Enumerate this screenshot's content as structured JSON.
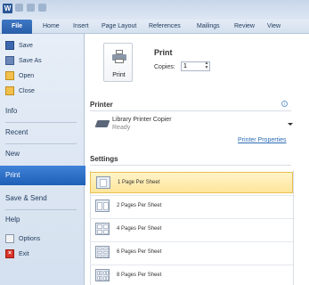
{
  "app": {
    "icon_letter": "W"
  },
  "ribbon": {
    "file_tab": "File",
    "tabs": [
      "Home",
      "Insert",
      "Page Layout",
      "References",
      "Mailings",
      "Review",
      "View"
    ]
  },
  "backstage": {
    "commands": [
      {
        "label": "Save",
        "icon": "save-icon"
      },
      {
        "label": "Save As",
        "icon": "save-as-icon"
      },
      {
        "label": "Open",
        "icon": "open-folder-icon"
      },
      {
        "label": "Close",
        "icon": "close-folder-icon"
      }
    ],
    "tabs": [
      "Info",
      "Recent",
      "New",
      "Print",
      "Save & Send",
      "Help"
    ],
    "active_tab": "Print",
    "bottom_commands": [
      {
        "label": "Options",
        "icon": "options-icon"
      },
      {
        "label": "Exit",
        "icon": "exit-icon"
      }
    ]
  },
  "print": {
    "heading": "Print",
    "button_label": "Print",
    "copies_label": "Copies:",
    "copies_value": "1"
  },
  "printer": {
    "heading": "Printer",
    "name": "Library Printer Copier",
    "status": "Ready",
    "properties_link": "Printer Properties"
  },
  "settings": {
    "heading": "Settings",
    "options": [
      "1 Page Per Sheet",
      "2 Pages Per Sheet",
      "4 Pages Per Sheet",
      "6 Pages Per Sheet",
      "8 Pages Per Sheet"
    ],
    "selected": "1 Page Per Sheet"
  },
  "colors": {
    "file_tab": "#2a5ea8",
    "active_tab": "#2a6bc4",
    "selected_option": "#ffe59a"
  }
}
